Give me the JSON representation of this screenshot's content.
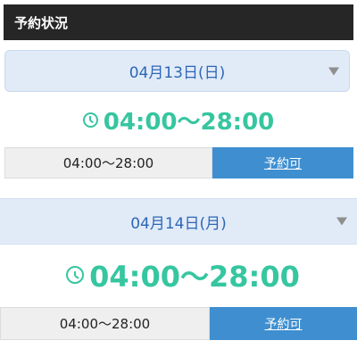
{
  "header": {
    "title": "予約状況"
  },
  "days": [
    {
      "date_label": "04月13日(日)",
      "hours_label": "04:00～28:00",
      "slot_time": "04:00～28:00",
      "slot_status": "予約可"
    },
    {
      "date_label": "04月14日(月)",
      "hours_label": "04:00～28:00",
      "slot_time": "04:00～28:00",
      "slot_status": "予約可"
    }
  ],
  "icons": {
    "clock": "clock-icon",
    "dropdown": "triangle-down-icon"
  },
  "colors": {
    "header_bg": "#262626",
    "date_text": "#2d66b6",
    "hours_text": "#36c6a0",
    "status_bg": "#3f8fd0"
  }
}
